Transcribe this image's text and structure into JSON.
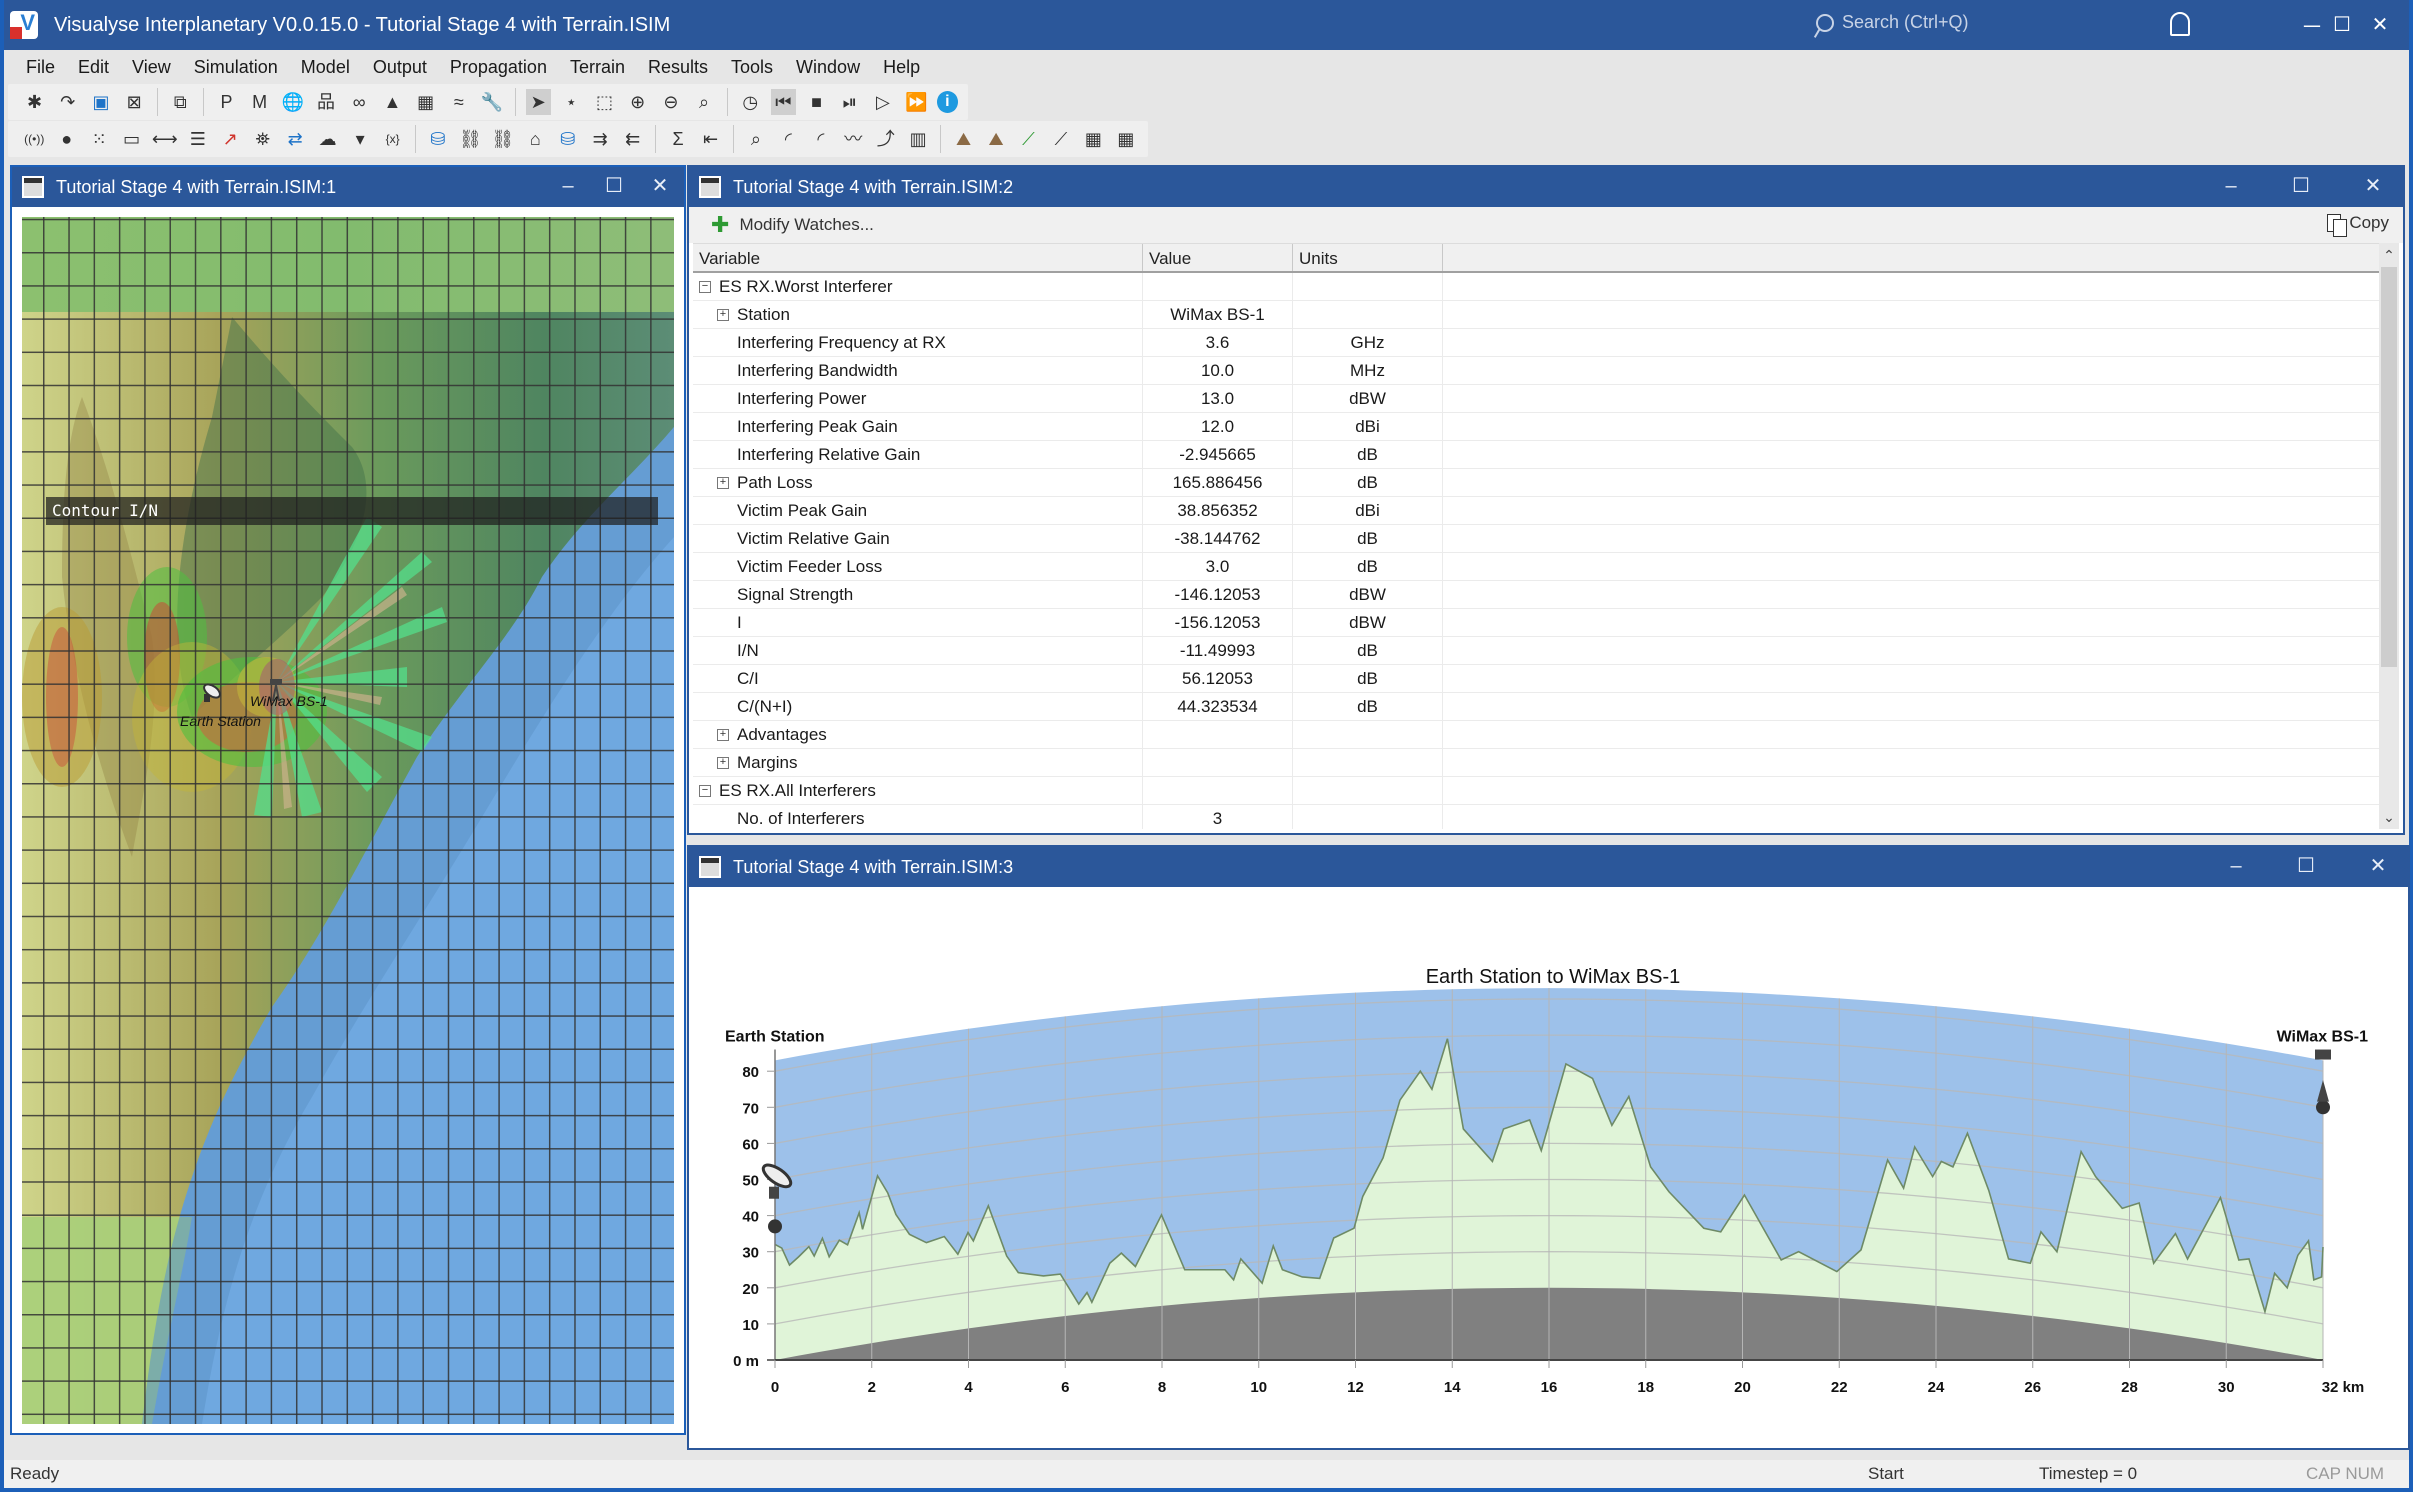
{
  "app": {
    "title": "Visualyse Interplanetary V0.0.15.0 - Tutorial Stage 4 with Terrain.ISIM",
    "search_placeholder": "Search (Ctrl+Q)",
    "window_controls": {
      "minimize": "–",
      "maximize": "☐",
      "close": "X"
    }
  },
  "menu": [
    "File",
    "Edit",
    "View",
    "Simulation",
    "Model",
    "Output",
    "Propagation",
    "Terrain",
    "Results",
    "Tools",
    "Window",
    "Help"
  ],
  "toolbar": {
    "row1": [
      {
        "icon": "new-file-icon"
      },
      {
        "icon": "open-file-icon"
      },
      {
        "icon": "save-icon"
      },
      {
        "icon": "close-file-icon"
      },
      {
        "sep": true
      },
      {
        "icon": "copy-icon"
      },
      {
        "sep": true
      },
      {
        "icon": "plot-window-icon",
        "glyph": "P"
      },
      {
        "icon": "map-window-icon",
        "glyph": "M"
      },
      {
        "icon": "globe-window-icon",
        "glyph": "🌐"
      },
      {
        "icon": "tree-window-icon",
        "glyph": "品"
      },
      {
        "icon": "watch-window-icon",
        "glyph": "∞"
      },
      {
        "icon": "terrain-window-icon",
        "glyph": "▲"
      },
      {
        "icon": "table-window-icon",
        "glyph": "▦"
      },
      {
        "icon": "signal-window-icon",
        "glyph": "≈"
      },
      {
        "icon": "settings-window-icon",
        "glyph": "🔧"
      },
      {
        "sep": true
      },
      {
        "icon": "select-pointer-icon",
        "active": true
      },
      {
        "icon": "magic-select-icon"
      },
      {
        "icon": "rect-select-icon"
      },
      {
        "icon": "zoom-in-icon"
      },
      {
        "icon": "zoom-out-icon"
      },
      {
        "icon": "zoom-100-icon"
      },
      {
        "sep": true
      },
      {
        "icon": "clock-icon"
      },
      {
        "icon": "reset-start-icon",
        "active": true
      },
      {
        "icon": "stop-icon"
      },
      {
        "icon": "step-icon"
      },
      {
        "icon": "play-icon"
      },
      {
        "icon": "fast-forward-icon"
      },
      {
        "icon": "info-icon"
      }
    ],
    "row2": [
      {
        "icon": "antenna-icon"
      },
      {
        "icon": "point-icon"
      },
      {
        "icon": "scatter-icon"
      },
      {
        "icon": "beam-icon"
      },
      {
        "icon": "link-icon"
      },
      {
        "icon": "multi-link-icon"
      },
      {
        "icon": "interference-arrow-icon"
      },
      {
        "icon": "satellite-icon"
      },
      {
        "icon": "swap-icon"
      },
      {
        "icon": "propagation-weather-icon"
      },
      {
        "icon": "dropdown-arrow-icon"
      },
      {
        "icon": "variable-icon"
      },
      {
        "sep": true
      },
      {
        "icon": "station-add-icon"
      },
      {
        "icon": "station-link-icon"
      },
      {
        "icon": "carrier-link-icon"
      },
      {
        "icon": "carrier-icon"
      },
      {
        "icon": "station-terrain-icon"
      },
      {
        "icon": "carrier-terrain-in-icon"
      },
      {
        "icon": "carrier-terrain-out-icon"
      },
      {
        "sep": true
      },
      {
        "icon": "sum-icon"
      },
      {
        "icon": "import-icon"
      },
      {
        "sep": true
      },
      {
        "icon": "search-report-icon"
      },
      {
        "icon": "contour-settings-icon"
      },
      {
        "icon": "contour-add-icon"
      },
      {
        "icon": "time-series-icon"
      },
      {
        "icon": "xy-plot-icon"
      },
      {
        "icon": "histogram-icon"
      },
      {
        "sep": true
      },
      {
        "icon": "terrain-settings-icon"
      },
      {
        "icon": "terrain-add-icon"
      },
      {
        "icon": "path-add-icon"
      },
      {
        "icon": "path-select-icon"
      },
      {
        "icon": "building-add-icon"
      },
      {
        "icon": "building-settings-icon"
      }
    ]
  },
  "map_window": {
    "title": "Tutorial Stage 4 with Terrain.ISIM:1",
    "overlay_label": "Contour I/N",
    "stations": [
      {
        "name": "Earth Station",
        "type": "earth-station"
      },
      {
        "name": "WiMax BS-1",
        "type": "base-station"
      }
    ]
  },
  "watch_window": {
    "title": "Tutorial Stage 4 with Terrain.ISIM:2",
    "modify_label": "Modify Watches...",
    "copy_label": "Copy",
    "columns": [
      "Variable",
      "Value",
      "Units"
    ],
    "rows": [
      {
        "level": 0,
        "toggle": "−",
        "variable": "ES RX.Worst Interferer",
        "value": "",
        "units": ""
      },
      {
        "level": 1,
        "toggle": "+",
        "variable": "Station",
        "value": "WiMax BS-1",
        "units": ""
      },
      {
        "level": 1,
        "variable": "Interfering Frequency at RX",
        "value": "3.6",
        "units": "GHz"
      },
      {
        "level": 1,
        "variable": "Interfering Bandwidth",
        "value": "10.0",
        "units": "MHz"
      },
      {
        "level": 1,
        "variable": "Interfering Power",
        "value": "13.0",
        "units": "dBW"
      },
      {
        "level": 1,
        "variable": "Interfering Peak Gain",
        "value": "12.0",
        "units": "dBi"
      },
      {
        "level": 1,
        "variable": "Interfering Relative Gain",
        "value": "-2.945665",
        "units": "dB"
      },
      {
        "level": 1,
        "toggle": "+",
        "variable": "Path Loss",
        "value": "165.886456",
        "units": "dB"
      },
      {
        "level": 1,
        "variable": "Victim Peak Gain",
        "value": "38.856352",
        "units": "dBi"
      },
      {
        "level": 1,
        "variable": "Victim Relative Gain",
        "value": "-38.144762",
        "units": "dB"
      },
      {
        "level": 1,
        "variable": "Victim Feeder Loss",
        "value": "3.0",
        "units": "dB"
      },
      {
        "level": 1,
        "variable": "Signal Strength",
        "value": "-146.12053",
        "units": "dBW"
      },
      {
        "level": 1,
        "variable": "I",
        "value": "-156.12053",
        "units": "dBW"
      },
      {
        "level": 1,
        "variable": "I/N",
        "value": "-11.49993",
        "units": "dB"
      },
      {
        "level": 1,
        "variable": "C/I",
        "value": "56.12053",
        "units": "dB"
      },
      {
        "level": 1,
        "variable": "C/(N+I)",
        "value": "44.323534",
        "units": "dB"
      },
      {
        "level": 1,
        "toggle": "+",
        "variable": "Advantages",
        "value": "",
        "units": ""
      },
      {
        "level": 1,
        "toggle": "+",
        "variable": "Margins",
        "value": "",
        "units": ""
      },
      {
        "level": 0,
        "toggle": "−",
        "variable": "ES RX.All Interferers",
        "value": "",
        "units": ""
      },
      {
        "level": 1,
        "variable": "No. of Interferers",
        "value": "3",
        "units": ""
      }
    ]
  },
  "chart_window": {
    "title": "Tutorial Stage 4 with Terrain.ISIM:3"
  },
  "chart_data": {
    "type": "area",
    "title": "Earth Station  to  WiMax BS-1",
    "left_station": "Earth Station",
    "right_station": "WiMax BS-1",
    "xlabel": "km",
    "ylabel": "m",
    "xlim": [
      0,
      32
    ],
    "ylim": [
      0,
      80
    ],
    "x_ticks": [
      "0",
      "2",
      "4",
      "6",
      "8",
      "10",
      "12",
      "14",
      "16",
      "18",
      "20",
      "22",
      "24",
      "26",
      "28",
      "30",
      "32 km"
    ],
    "y_ticks": [
      "0 m",
      "10",
      "20",
      "30",
      "40",
      "50",
      "60",
      "70",
      "80"
    ],
    "earth_bulge_max_m": 20,
    "sky_top_at_ends_m": 83,
    "left_antenna_height_m": 37,
    "right_antenna_height_m": 70,
    "grid": true,
    "colors": {
      "sky": "#9dc1ea",
      "terrain": "#e0f4d8",
      "terrain_line": "#6e8a66",
      "earth": "#808080"
    },
    "terrain_profile": {
      "x_km": [
        0,
        0.14,
        0.3,
        0.49,
        0.7,
        0.81,
        0.98,
        1.12,
        1.33,
        1.5,
        1.74,
        1.81,
        2.12,
        2.33,
        2.5,
        2.78,
        3.13,
        3.5,
        3.78,
        3.99,
        4.1,
        4.41,
        4.79,
        5.03,
        5.55,
        5.9,
        6.28,
        6.45,
        6.55,
        6.92,
        7.16,
        7.45,
        7.99,
        8.47,
        9.3,
        9.48,
        9.63,
        10.07,
        10.3,
        10.49,
        10.9,
        11.26,
        11.55,
        11.97,
        12.15,
        12.57,
        12.92,
        13.34,
        13.58,
        13.9,
        14.23,
        14.83,
        15.06,
        15.6,
        15.84,
        16.35,
        16.9,
        17.3,
        17.65,
        18.1,
        18.48,
        19.2,
        19.55,
        20.04,
        20.8,
        21.16,
        21.95,
        22.45,
        23.0,
        23.33,
        23.56,
        23.93,
        24.11,
        24.35,
        24.65,
        25.09,
        25.5,
        25.95,
        26.17,
        26.5,
        27.0,
        27.3,
        27.85,
        28.2,
        28.5,
        28.95,
        29.2,
        29.88,
        30.26,
        30.47,
        30.8,
        31.0,
        31.26,
        31.48,
        31.7,
        31.81,
        31.97,
        32.0
      ],
      "height_m": [
        32,
        31,
        26.3,
        28.6,
        31.4,
        28.8,
        33.7,
        28.6,
        33.2,
        31.9,
        40.8,
        36.2,
        51,
        46.3,
        40.3,
        34.8,
        32.5,
        34.2,
        29.3,
        35.3,
        33,
        42.7,
        28.8,
        24.2,
        23.3,
        23.8,
        15.5,
        18.7,
        16,
        26.8,
        29.6,
        25.9,
        40.2,
        25,
        25,
        22.2,
        28,
        21.3,
        31.6,
        25,
        23,
        22.6,
        33.8,
        36.5,
        45.3,
        56,
        72,
        80,
        75,
        89,
        64,
        55,
        64,
        66.5,
        58,
        82,
        78,
        65,
        73,
        53.5,
        46.6,
        36.5,
        35.5,
        45.7,
        27.7,
        30,
        24.5,
        30.5,
        55.4,
        47.6,
        59,
        50.8,
        55,
        53.5,
        62.8,
        47,
        28,
        26.8,
        35.5,
        30,
        57.7,
        50.8,
        42,
        43.5,
        26.8,
        35,
        28,
        45,
        27.7,
        28,
        13.4,
        24,
        20,
        29,
        33,
        22.2,
        23,
        31.3
      ]
    }
  },
  "status": {
    "left": "Ready",
    "mode": "Start",
    "timestep": "Timestep = 0",
    "keys": "CAP NUM"
  }
}
